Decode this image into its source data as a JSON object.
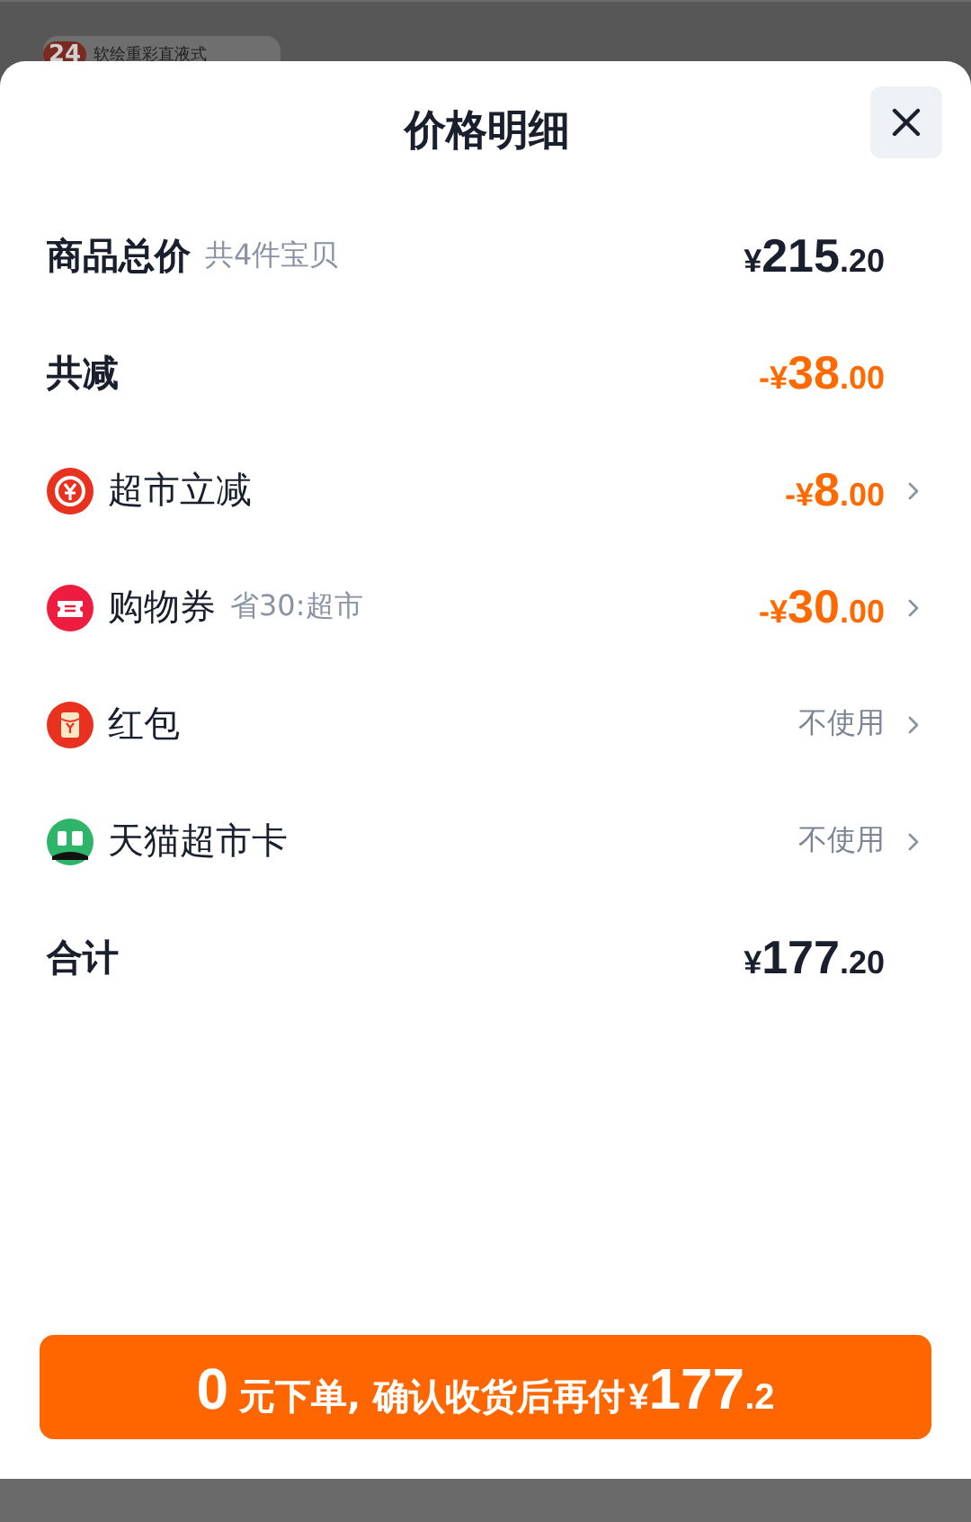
{
  "background": {
    "badge": "24",
    "product": "软绘重彩直液式"
  },
  "sheet": {
    "title": "价格明细",
    "rows": [
      {
        "kind": "plain",
        "label": "商品总价",
        "note": "共4件宝贝",
        "amount": {
          "prefix": "¥",
          "int": "215",
          "dec": ".20"
        },
        "chevron": false
      },
      {
        "kind": "deduction",
        "label": "共减",
        "amount": {
          "prefix": "-¥",
          "int": "38",
          "dec": ".00"
        },
        "chevron": false
      },
      {
        "kind": "discount",
        "label": "超市立减",
        "amount": {
          "prefix": "-¥",
          "int": "8",
          "dec": ".00"
        },
        "chevron": true
      },
      {
        "kind": "discount",
        "label": "购物券",
        "note": "省30:超市",
        "amount": {
          "prefix": "-¥",
          "int": "30",
          "dec": ".00"
        },
        "chevron": true
      },
      {
        "kind": "discount",
        "label": "红包",
        "action": "不使用",
        "chevron": true
      },
      {
        "kind": "discount",
        "label": "天猫超市卡",
        "action": "不使用",
        "chevron": true
      },
      {
        "kind": "plain",
        "label": "合计",
        "amount": {
          "prefix": "¥",
          "int": "177",
          "dec": ".20"
        },
        "chevron": false
      }
    ],
    "button": {
      "lead": "0",
      "middle": "元下单, 确认收货后再付",
      "currency": "¥",
      "int": "177",
      "dec": ".2"
    }
  }
}
